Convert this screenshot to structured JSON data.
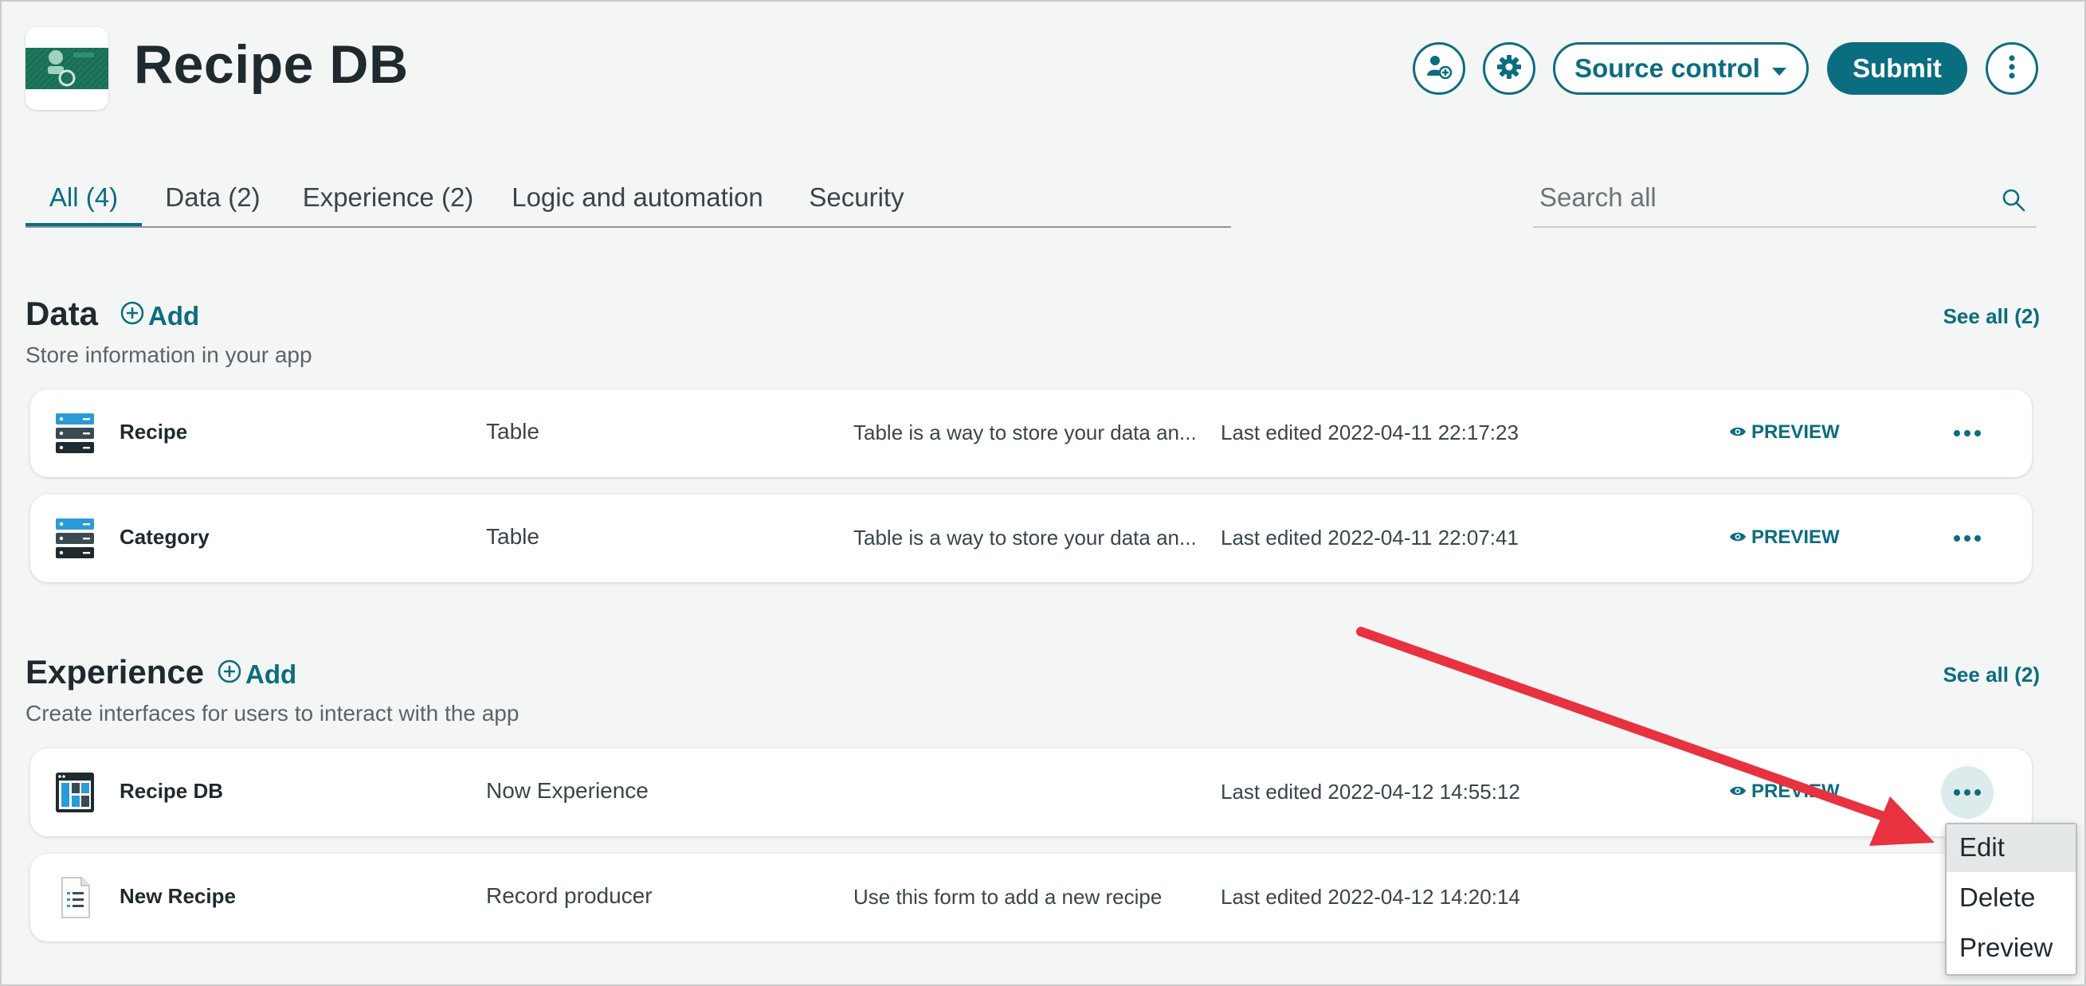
{
  "header": {
    "title": "Recipe DB",
    "source_control_label": "Source control",
    "submit_label": "Submit"
  },
  "tabs": [
    {
      "label": "All (4)",
      "active": true
    },
    {
      "label": "Data (2)"
    },
    {
      "label": "Experience (2)"
    },
    {
      "label": "Logic and automation"
    },
    {
      "label": "Security"
    }
  ],
  "search": {
    "placeholder": "Search all"
  },
  "sections": {
    "data": {
      "title": "Data",
      "add_label": "Add",
      "description": "Store information in your app",
      "see_all": "See all (2)",
      "rows": [
        {
          "name": "Recipe",
          "type": "Table",
          "description": "Table is a way to store your data an...",
          "edited": "Last edited 2022-04-11 22:17:23",
          "preview": "PREVIEW",
          "icon": "table-icon"
        },
        {
          "name": "Category",
          "type": "Table",
          "description": "Table is a way to store your data an...",
          "edited": "Last edited 2022-04-11 22:07:41",
          "preview": "PREVIEW",
          "icon": "table-icon"
        }
      ]
    },
    "experience": {
      "title": "Experience",
      "add_label": "Add",
      "description": "Create interfaces for users to interact with the app",
      "see_all": "See all (2)",
      "rows": [
        {
          "name": "Recipe DB",
          "type": "Now Experience",
          "description": "",
          "edited": "Last edited 2022-04-12 14:55:12",
          "preview": "PREVIEW",
          "icon": "experience-icon"
        },
        {
          "name": "New Recipe",
          "type": "Record producer",
          "description": "Use this form to add a new recipe",
          "edited": "Last edited 2022-04-12 14:20:14",
          "preview": "",
          "icon": "form-icon"
        }
      ]
    }
  },
  "context_menu": {
    "items": [
      "Edit",
      "Delete",
      "Preview"
    ],
    "hovered": "Edit"
  },
  "colors": {
    "accent": "#0b6d80",
    "annotation_arrow": "#e8323f",
    "background": "#f4f5f5"
  }
}
